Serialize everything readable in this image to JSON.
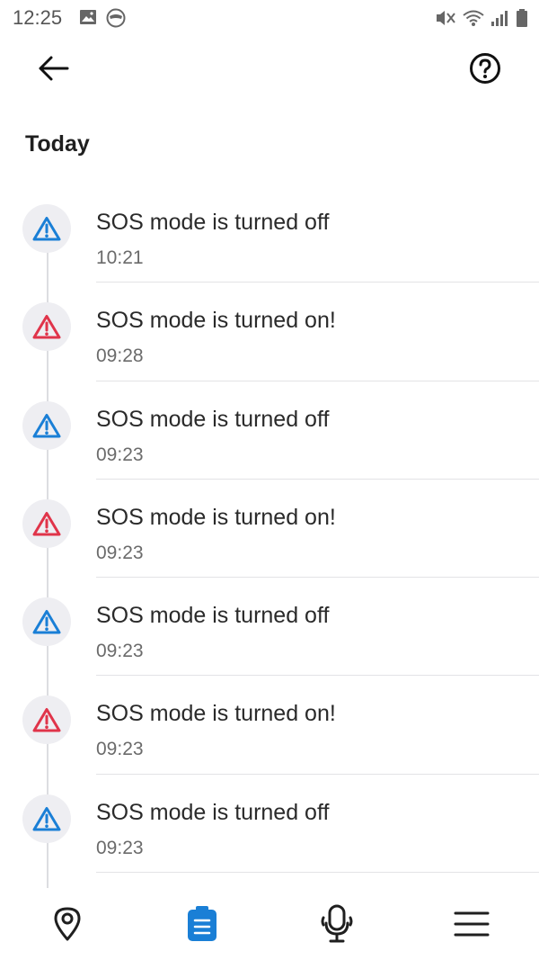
{
  "status_bar": {
    "time": "12:25",
    "left_icons": [
      "image-icon",
      "mask-icon"
    ],
    "right_icons": [
      "vibrate-mute-icon",
      "wifi-icon",
      "signal-icon",
      "battery-icon"
    ]
  },
  "header": {
    "back_icon": "arrow-left-icon",
    "help_icon": "help-circle-icon"
  },
  "section": {
    "title": "Today"
  },
  "colors": {
    "off_icon": "#1a7fd6",
    "on_icon": "#e0344a",
    "active_nav": "#1a7fd6",
    "inactive_nav": "#1f1f1f"
  },
  "events": [
    {
      "title": "SOS mode is turned off",
      "time": "10:21",
      "state": "off"
    },
    {
      "title": "SOS mode is turned on!",
      "time": "09:28",
      "state": "on"
    },
    {
      "title": "SOS mode is turned off",
      "time": "09:23",
      "state": "off"
    },
    {
      "title": "SOS mode is turned on!",
      "time": "09:23",
      "state": "on"
    },
    {
      "title": "SOS mode is turned off",
      "time": "09:23",
      "state": "off"
    },
    {
      "title": "SOS mode is turned on!",
      "time": "09:23",
      "state": "on"
    },
    {
      "title": "SOS mode is turned off",
      "time": "09:23",
      "state": "off"
    }
  ],
  "bottom_nav": [
    {
      "name": "nav-location",
      "icon": "location-pin-icon",
      "active": false
    },
    {
      "name": "nav-history",
      "icon": "clipboard-icon",
      "active": true
    },
    {
      "name": "nav-microphone",
      "icon": "microphone-icon",
      "active": false
    },
    {
      "name": "nav-menu",
      "icon": "menu-icon",
      "active": false
    }
  ]
}
